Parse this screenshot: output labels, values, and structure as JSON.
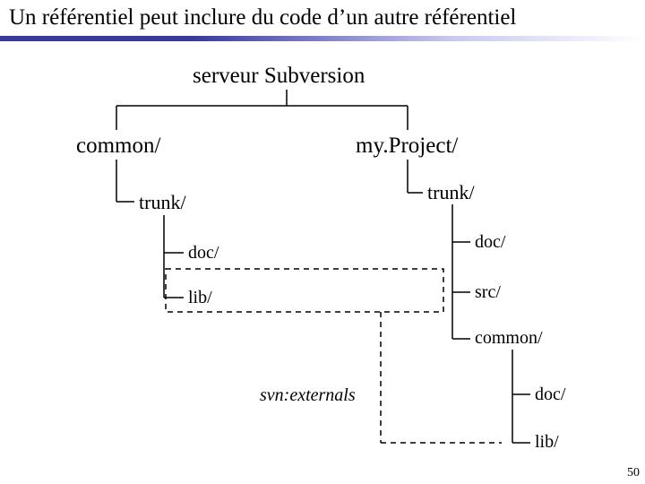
{
  "title": "Un référentiel peut inclure du code d’un autre référentiel",
  "root": "serveur Subversion",
  "left": {
    "repo": "common/",
    "trunk": "trunk/",
    "doc": "doc/",
    "lib": "lib/"
  },
  "right": {
    "repo": "my.Project/",
    "trunk": "trunk/",
    "doc": "doc/",
    "src": "src/",
    "common": "common/",
    "common_doc": "doc/",
    "common_lib": "lib/"
  },
  "externals_label": "svn:externals",
  "slide_number": "50"
}
